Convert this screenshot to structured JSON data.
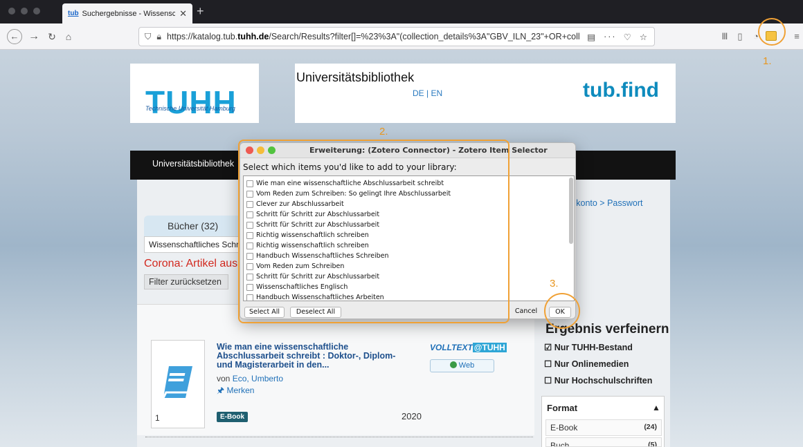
{
  "browser": {
    "tab_title": "Suchergebnisse - Wissenschaftl",
    "tab_favicon": "tub",
    "url_prefix": "https://katalog.tub.",
    "url_domain": "tuhh.de",
    "url_path": "/Search/Results?filter[]=%23%3A\"(collection_details%3A\"GBV_ILN_23\"+OR+collectio",
    "url_more": "···"
  },
  "annotations": {
    "one": "1.",
    "two": "2.",
    "three": "3."
  },
  "header": {
    "logo": "TUHH",
    "logo_sub": "Technische Universität Hamburg",
    "library_title": "Universitätsbibliothek",
    "lang": "DE | EN",
    "brand": "tub.find"
  },
  "menu": {
    "item": "Universitätsbibliothek"
  },
  "account_links": "skonto    > Passwort",
  "search": {
    "tab_label": "Bücher (32)",
    "query": "Wissenschaftliches Schreiben",
    "notice": "Corona: Artikel aus Z",
    "filter_reset": "Filter zurücksetzen"
  },
  "result": {
    "number": "1",
    "title": "Wie man eine wissenschaftliche Abschlussarbeit schreibt : Doktor-, Diplom- und Magisterarbeit in den...",
    "author_prefix": "von",
    "author": "Eco, Umberto",
    "merken": "Merken",
    "badge": "E-Book",
    "year": "2020",
    "volltext": "VOLLTEXT",
    "volltext_tag": "@TUHH",
    "web": "Web"
  },
  "refine": {
    "title": "Ergebnis verfeinern",
    "filters": [
      {
        "label": "Nur TUHH-Bestand",
        "checked": "☑"
      },
      {
        "label": "Nur Onlinemedien",
        "checked": "☐"
      },
      {
        "label": "Nur Hochschulschriften",
        "checked": "☐"
      }
    ],
    "format_title": "Format",
    "formats": [
      {
        "label": "E-Book",
        "count": "(24)"
      },
      {
        "label": "Buch",
        "count": "(5)"
      }
    ]
  },
  "dialog": {
    "title": "Erweiterung: (Zotero Connector) - Zotero Item Selector",
    "prompt": "Select which items you'd like to add to your library:",
    "items": [
      "Wie man eine wissenschaftliche Abschlussarbeit schreibt",
      "Vom Reden zum Schreiben: So gelingt Ihre Abschlussarbeit",
      "Clever zur Abschlussarbeit",
      "Schritt für Schritt zur Abschlussarbeit",
      "Schritt für Schritt zur Abschlussarbeit",
      "Richtig wissenschaftlich schreiben",
      "Richtig wissenschaftlich schreiben",
      "Handbuch Wissenschaftliches Schreiben",
      "Vom Reden zum Schreiben",
      "Schritt für Schritt zur Abschlussarbeit",
      "Wissenschaftliches Englisch",
      "Handbuch Wissenschaftliches Arbeiten"
    ],
    "select_all": "Select All",
    "deselect_all": "Deselect All",
    "cancel": "Cancel",
    "ok": "OK"
  },
  "colors": {
    "accent": "#f0a135",
    "tuhh_blue": "#1aa0d8",
    "corona_red": "#d2281e"
  }
}
